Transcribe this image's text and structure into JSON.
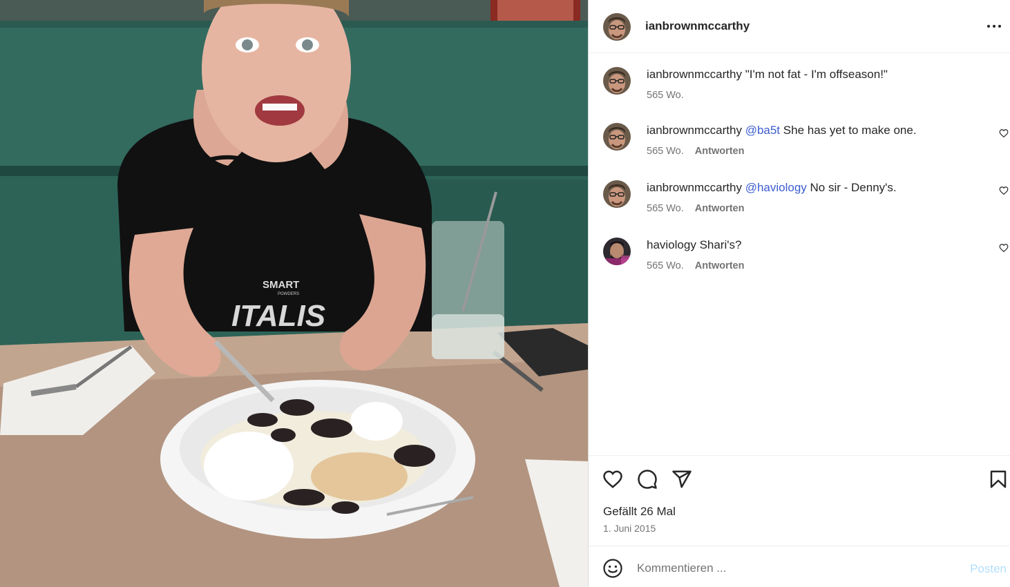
{
  "post": {
    "username": "ianbrownmccarthy",
    "more_icon": "more-horizontal-icon",
    "photo_shirt_text_1": "SMART",
    "photo_shirt_text_2": "POWDERS",
    "photo_shirt_text_3": "ITALIS"
  },
  "comments": [
    {
      "user": "ianbrownmccarthy",
      "mention": "",
      "text": "\"I'm not fat - I'm offseason!\"",
      "time": "565 Wo.",
      "reply": "",
      "avatar": "ian"
    },
    {
      "user": "ianbrownmccarthy",
      "mention": "@ba5t",
      "text": "She has yet to make one.",
      "time": "565 Wo.",
      "reply": "Antworten",
      "avatar": "ian"
    },
    {
      "user": "ianbrownmccarthy",
      "mention": "@haviology",
      "text": "No sir - Denny's.",
      "time": "565 Wo.",
      "reply": "Antworten",
      "avatar": "ian"
    },
    {
      "user": "haviology",
      "mention": "",
      "text": "Shari's?",
      "time": "565 Wo.",
      "reply": "Antworten",
      "avatar": "havi"
    }
  ],
  "actions": {
    "like_icon": "heart-icon",
    "comment_icon": "comment-icon",
    "share_icon": "paper-plane-icon",
    "save_icon": "bookmark-icon",
    "likes_text": "Gefällt 26 Mal",
    "date": "1. Juni 2015"
  },
  "composer": {
    "emoji_icon": "emoji-icon",
    "placeholder": "Kommentieren ...",
    "value": "",
    "post_label": "Posten"
  },
  "colors": {
    "text": "#262626",
    "secondary": "#737373",
    "link": "#3b5ccf",
    "post_button_disabled": "#b2dffc",
    "border": "#dbdbdb"
  }
}
